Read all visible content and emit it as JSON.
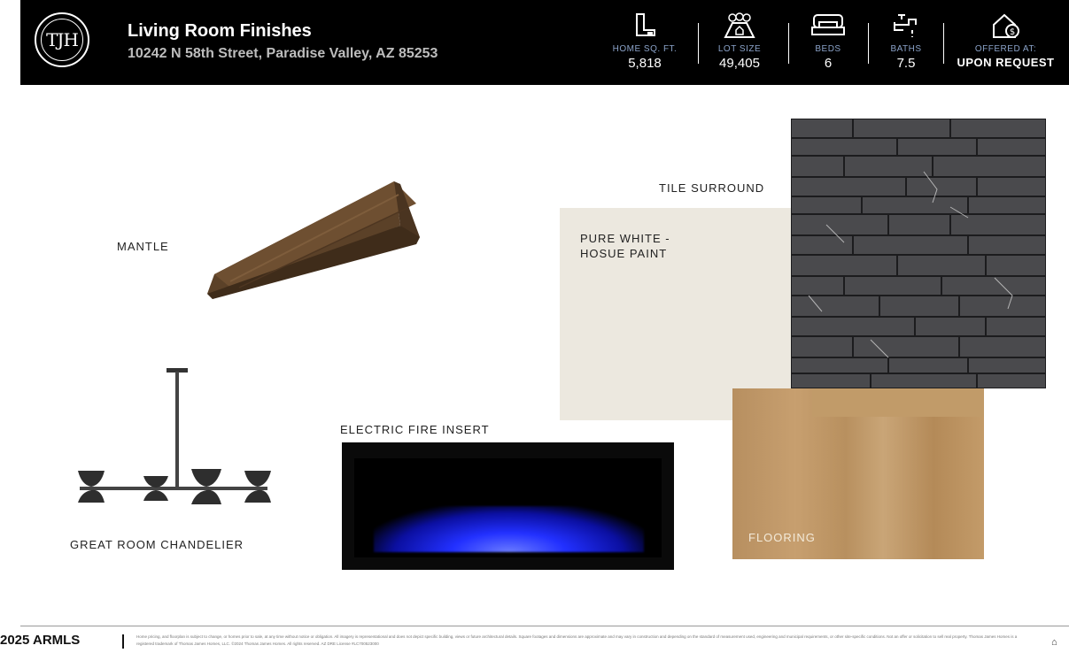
{
  "header": {
    "logo_text": "TJH",
    "title": "Living Room Finishes",
    "address": "10242 N 58th Street, Paradise Valley, AZ 85253",
    "stats": [
      {
        "label": "HOME SQ. FT.",
        "value": "5,818",
        "icon": "floorplan-icon"
      },
      {
        "label": "LOT SIZE",
        "value": "49,405",
        "icon": "lot-icon"
      },
      {
        "label": "BEDS",
        "value": "6",
        "icon": "bed-icon"
      },
      {
        "label": "BATHS",
        "value": "7.5",
        "icon": "faucet-icon"
      },
      {
        "label": "OFFERED AT:",
        "value": "UPON REQUEST",
        "icon": "house-dollar-icon"
      }
    ]
  },
  "finishes": {
    "mantle": "MANTLE",
    "tile_surround": "TILE SURROUND",
    "paint_line1": "PURE WHITE -",
    "paint_line2": "HOSUE PAINT",
    "electric_fire": "ELECTRIC FIRE INSERT",
    "chandelier": "GREAT ROOM CHANDELIER",
    "flooring": "FLOORING"
  },
  "footer": {
    "brand": "2025 ARMLS",
    "disclaimer": "Home pricing, and floorplan is subject to change, or homes prior to sale, at any time without notice or obligation. All imagery is representational and does not depict specific building, views or future architectural details. Square footages and dimensions are approximate and may vary in construction and depending on the standard of measurement used, engineering and municipal requirements, or other site-specific conditions. Not an offer or solicitation to sell real property. Thomas James Homes is a registered trademark of Thomas James Homes, LLC. ©2024 Thomas James Homes. All rights reserved. AZ DRE License #LC700523000",
    "eho": "⌂"
  },
  "colors": {
    "header_bg": "#000000",
    "stat_label": "#8aa2c8",
    "paint_swatch": "#ece8df"
  }
}
